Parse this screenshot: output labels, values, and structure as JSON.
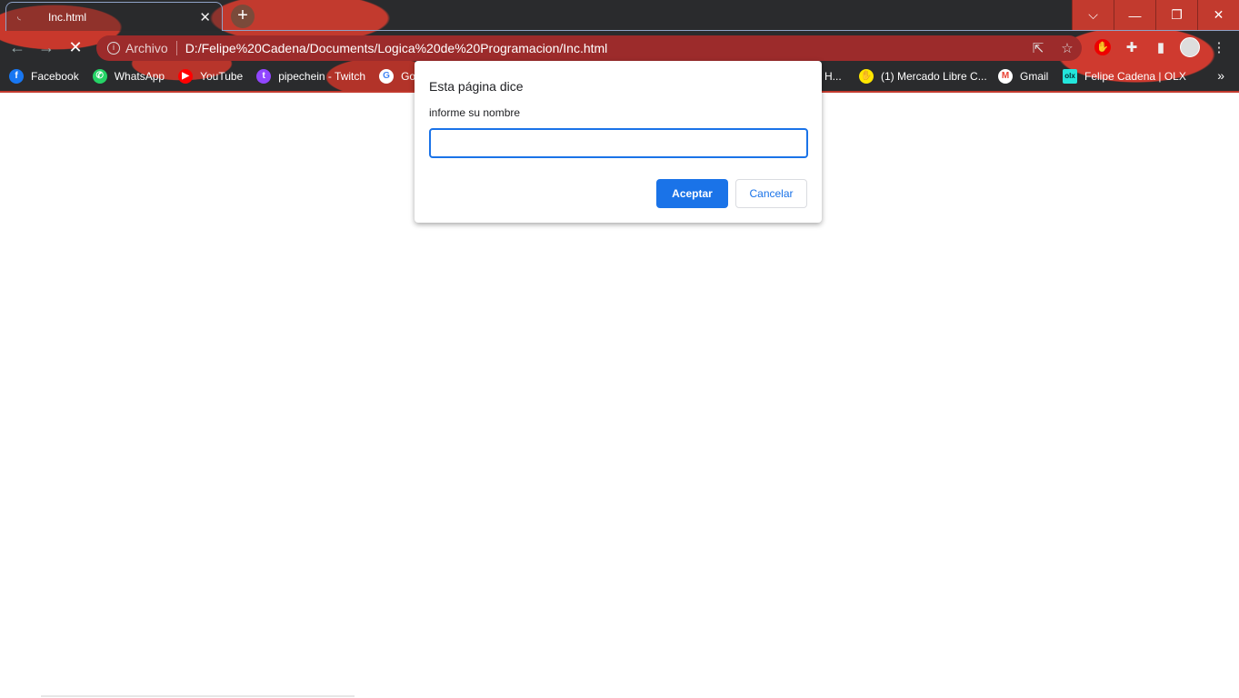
{
  "tab": {
    "title": "Inc.html",
    "close": "✕",
    "new_tab": "+"
  },
  "window": {
    "dropdown": "⌵",
    "minimize": "—",
    "restore": "❐",
    "close": "✕"
  },
  "nav": {
    "back": "←",
    "forward": "→",
    "stop": "✕"
  },
  "omnibox": {
    "info": "i",
    "scheme_label": "Archivo",
    "url": "D:/Felipe%20Cadena/Documents/Logica%20de%20Programacion/Inc.html"
  },
  "bookmarks": [
    {
      "label": "Facebook",
      "icon": "facebook-icon",
      "color": "#1877f2",
      "glyph": "f"
    },
    {
      "label": "WhatsApp",
      "icon": "whatsapp-icon",
      "color": "#25d366",
      "glyph": "✆"
    },
    {
      "label": "YouTube",
      "icon": "youtube-icon",
      "color": "#ff0000",
      "glyph": "▶"
    },
    {
      "label": "pipechein - Twitch",
      "icon": "twitch-icon",
      "color": "#9146ff",
      "glyph": "t"
    },
    {
      "label": "Google",
      "icon": "google-icon",
      "color": "#4285f4",
      "glyph": "G"
    },
    {
      "label": "e H...",
      "icon": "bookmark-icon",
      "color": "#888888",
      "glyph": ""
    },
    {
      "label": "(1) Mercado Libre C...",
      "icon": "mercadolibre-icon",
      "color": "#ffe600",
      "glyph": "✋"
    },
    {
      "label": "Gmail",
      "icon": "gmail-icon",
      "color": "#ea4335",
      "glyph": "M"
    },
    {
      "label": "Felipe Cadena | OLX",
      "icon": "olx-icon",
      "color": "#23e5db",
      "glyph": "olx"
    }
  ],
  "more_bookmarks": "»",
  "dialog": {
    "title": "Esta página dice",
    "message": "informe su nombre",
    "input_value": "",
    "ok": "Aceptar",
    "cancel": "Cancelar"
  }
}
